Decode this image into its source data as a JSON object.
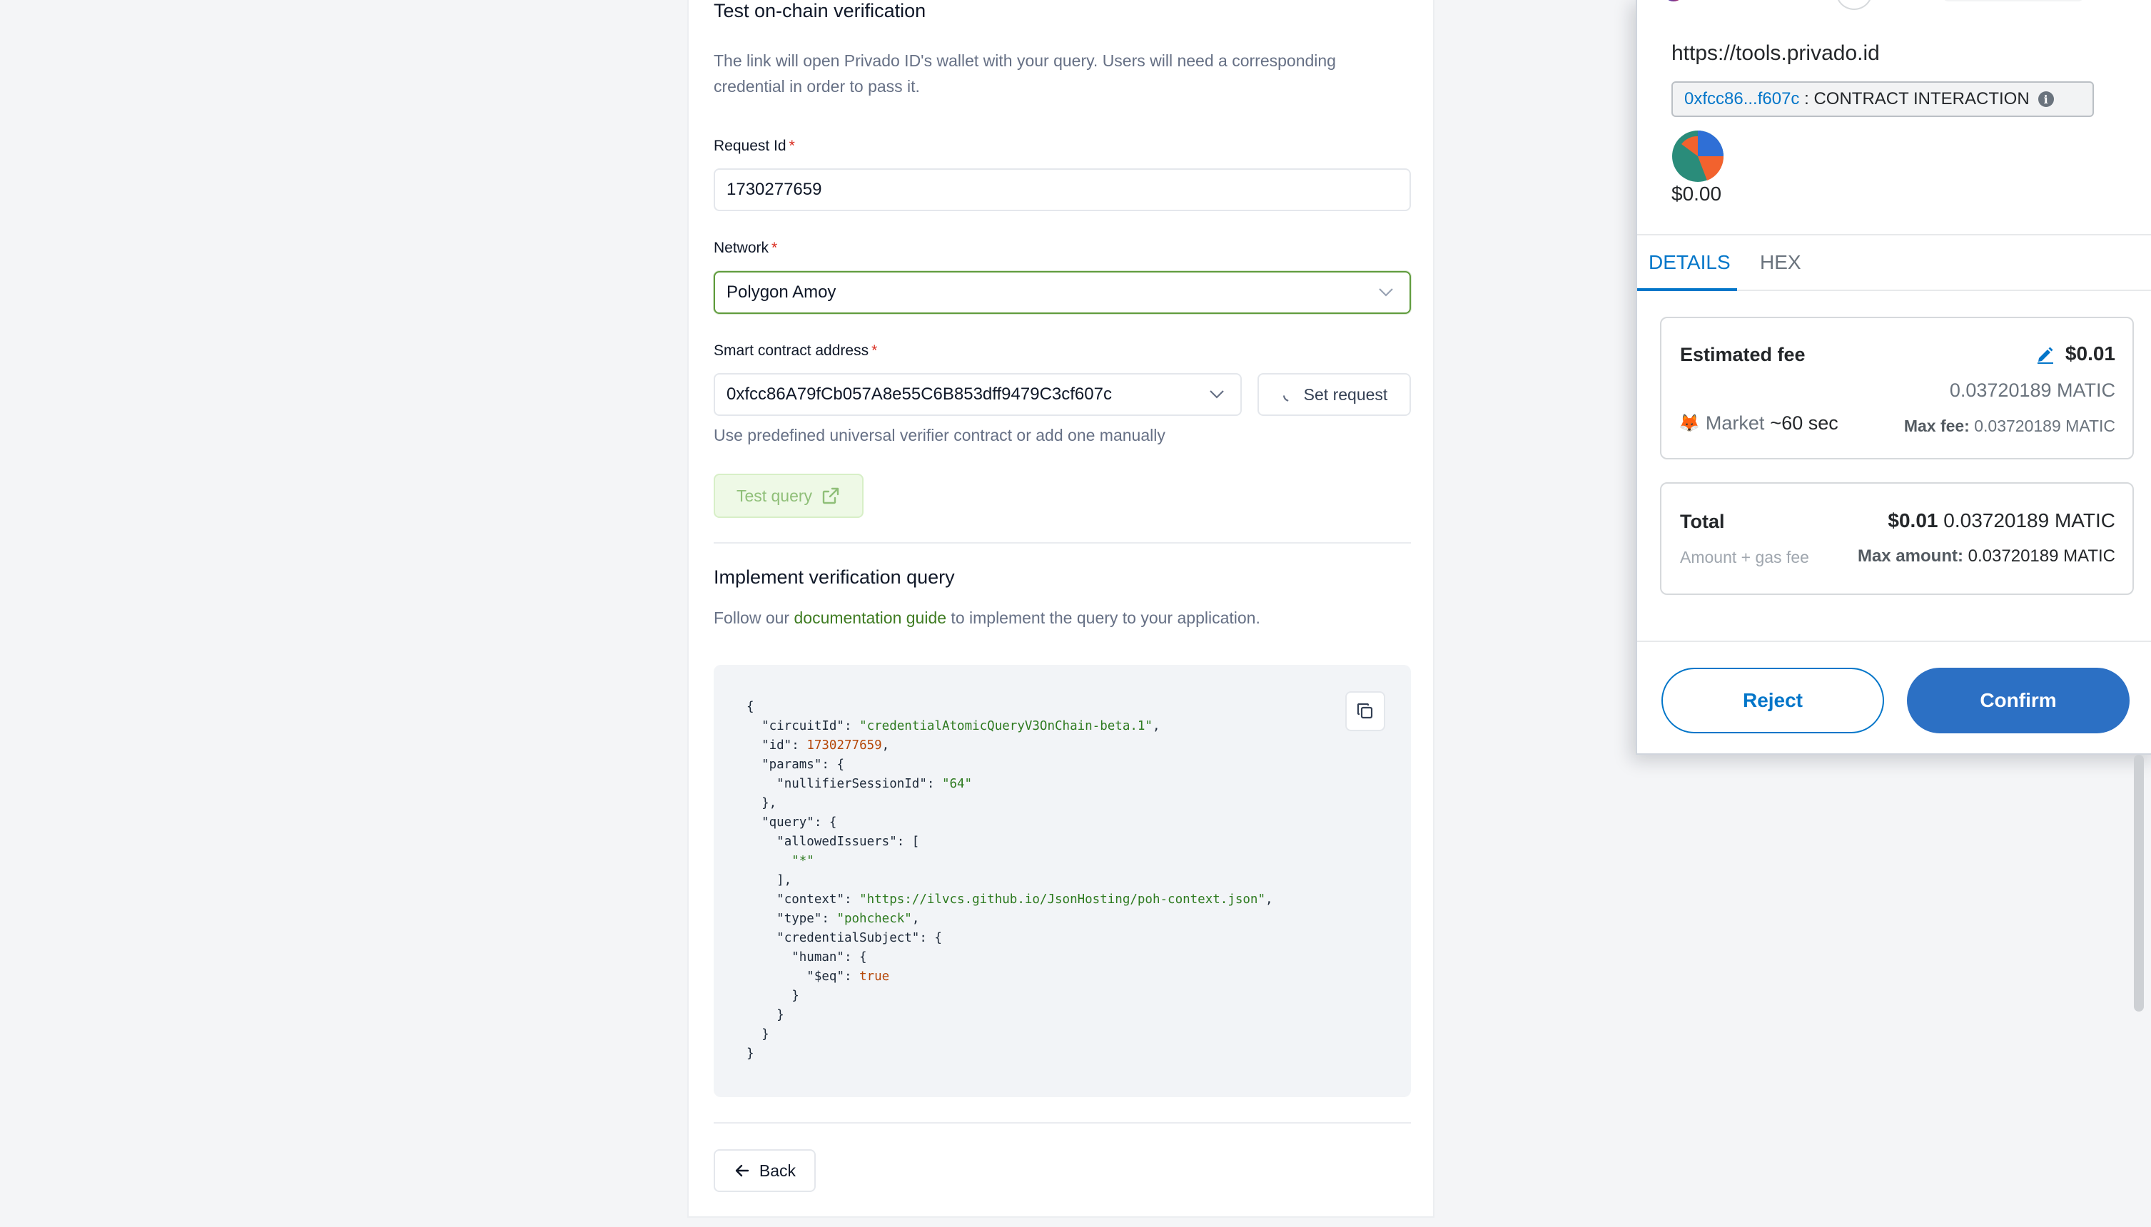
{
  "section_test": {
    "title": "Test on-chain verification",
    "description": "The link will open Privado ID's wallet with your query. Users will need a corresponding credential in order to pass it."
  },
  "form": {
    "request_id_label": "Request Id",
    "request_id_value": "1730277659",
    "network_label": "Network",
    "network_value": "Polygon Amoy",
    "contract_label": "Smart contract address",
    "contract_value": "0xfcc86A79fCb057A8e55C6B853dff9479C3cf607c",
    "set_request_label": "Set request",
    "contract_hint": "Use predefined universal verifier contract or add one manually",
    "test_query_label": "Test query",
    "required_mark": "*"
  },
  "section_implement": {
    "title": "Implement verification query",
    "desc_prefix": "Follow our ",
    "desc_link": "documentation guide",
    "desc_suffix": " to implement the query to your application."
  },
  "code": {
    "open": "{",
    "circuit_key": "\"circuitId\"",
    "circuit_val": "\"credentialAtomicQueryV3OnChain-beta.1\"",
    "id_key": "\"id\"",
    "id_val": "1730277659",
    "params_key": "\"params\"",
    "nullifier_key": "\"nullifierSessionId\"",
    "nullifier_val": "\"64\"",
    "query_key": "\"query\"",
    "allowed_key": "\"allowedIssuers\"",
    "allowed_val": "\"*\"",
    "context_key": "\"context\"",
    "context_val": "\"https://ilvcs.github.io/JsonHosting/poh-context.json\"",
    "type_key": "\"type\"",
    "type_val": "\"pohcheck\"",
    "cs_key": "\"credentialSubject\"",
    "human_key": "\"human\"",
    "eq_key": "\"$eq\"",
    "eq_val": "true",
    "close": "}"
  },
  "back_label": "Back",
  "wallet": {
    "origin": "https://tools.privado.id",
    "contract_short": "0xfcc86...f607c",
    "contract_sep": " : ",
    "contract_kind": "CONTRACT INTERACTION",
    "balance": "$0.00",
    "tabs": [
      "DETAILS",
      "HEX"
    ],
    "fee": {
      "label": "Estimated fee",
      "usd": "$0.01",
      "native": "0.03720189 MATIC",
      "speed_emoji": "🦊",
      "speed_name": "Market",
      "speed_time": "~60 sec",
      "max_fee_label": "Max fee:",
      "max_fee_value": "0.03720189 MATIC"
    },
    "total": {
      "label": "Total",
      "usd": "$0.01",
      "native": "0.03720189 MATIC",
      "sub_label": "Amount + gas fee",
      "max_label": "Max amount:",
      "max_value": "0.03720189 MATIC"
    },
    "reject_label": "Reject",
    "confirm_label": "Confirm"
  }
}
